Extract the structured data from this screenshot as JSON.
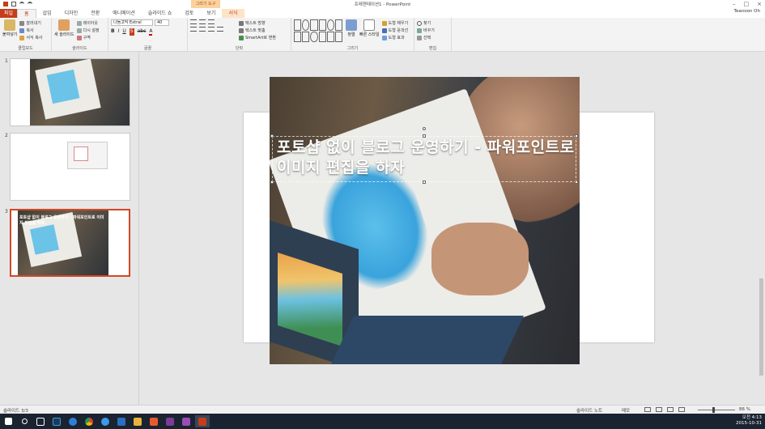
{
  "titlebar": {
    "title": "프레젠테이션1 - PowerPoint",
    "user": "Teanoon Oh"
  },
  "context_tab_header": "그리기 도구",
  "tabs": [
    {
      "label": "파일",
      "kind": "file"
    },
    {
      "label": "홈",
      "kind": "active"
    },
    {
      "label": "삽입",
      "kind": ""
    },
    {
      "label": "디자인",
      "kind": ""
    },
    {
      "label": "전환",
      "kind": ""
    },
    {
      "label": "애니메이션",
      "kind": ""
    },
    {
      "label": "슬라이드 쇼",
      "kind": ""
    },
    {
      "label": "검토",
      "kind": ""
    },
    {
      "label": "보기",
      "kind": ""
    },
    {
      "label": "서식",
      "kind": "ctx"
    }
  ],
  "ribbon": {
    "clipboard": {
      "paste": "붙여넣기",
      "cut": "잘라내기",
      "copy": "복사",
      "format_painter": "서식 복사",
      "label": "클립보드"
    },
    "slides": {
      "new_slide": "새 슬라이드",
      "layout": "레이아웃",
      "reset": "다시 설정",
      "section": "구역",
      "label": "슬라이드"
    },
    "font": {
      "name": "나눔고딕 ExtraI",
      "size": "40",
      "label": "글꼴"
    },
    "paragraph": {
      "text_direction": "텍스트 방향",
      "align_text": "텍스트 맞춤",
      "smartart": "SmartArt로 변환",
      "label": "단락"
    },
    "drawing": {
      "arrange": "정렬",
      "quick_styles": "빠른 스타일",
      "fill": "도형 채우기",
      "outline": "도형 윤곽선",
      "effects": "도형 효과",
      "label": "그리기"
    },
    "editing": {
      "find": "찾기",
      "replace": "바꾸기",
      "select": "선택",
      "label": "편집"
    }
  },
  "thumbnails": [
    {
      "num": "1"
    },
    {
      "num": "2"
    },
    {
      "num": "3",
      "title": "포토샵 없이 블로그 운영하기 - 파워포인트로 이미지 편집을 하자"
    }
  ],
  "slide": {
    "title": "포토샵 없이 블로그 운영하기 - 파워포인트로 이미지 편집을 하자"
  },
  "status": {
    "slide_count": "슬라이드 3/3",
    "notes": "슬라이드 노트",
    "comments": "메모",
    "zoom": "86 %"
  },
  "tray": {
    "time": "오전 4:13",
    "date": "2015-10-31"
  }
}
